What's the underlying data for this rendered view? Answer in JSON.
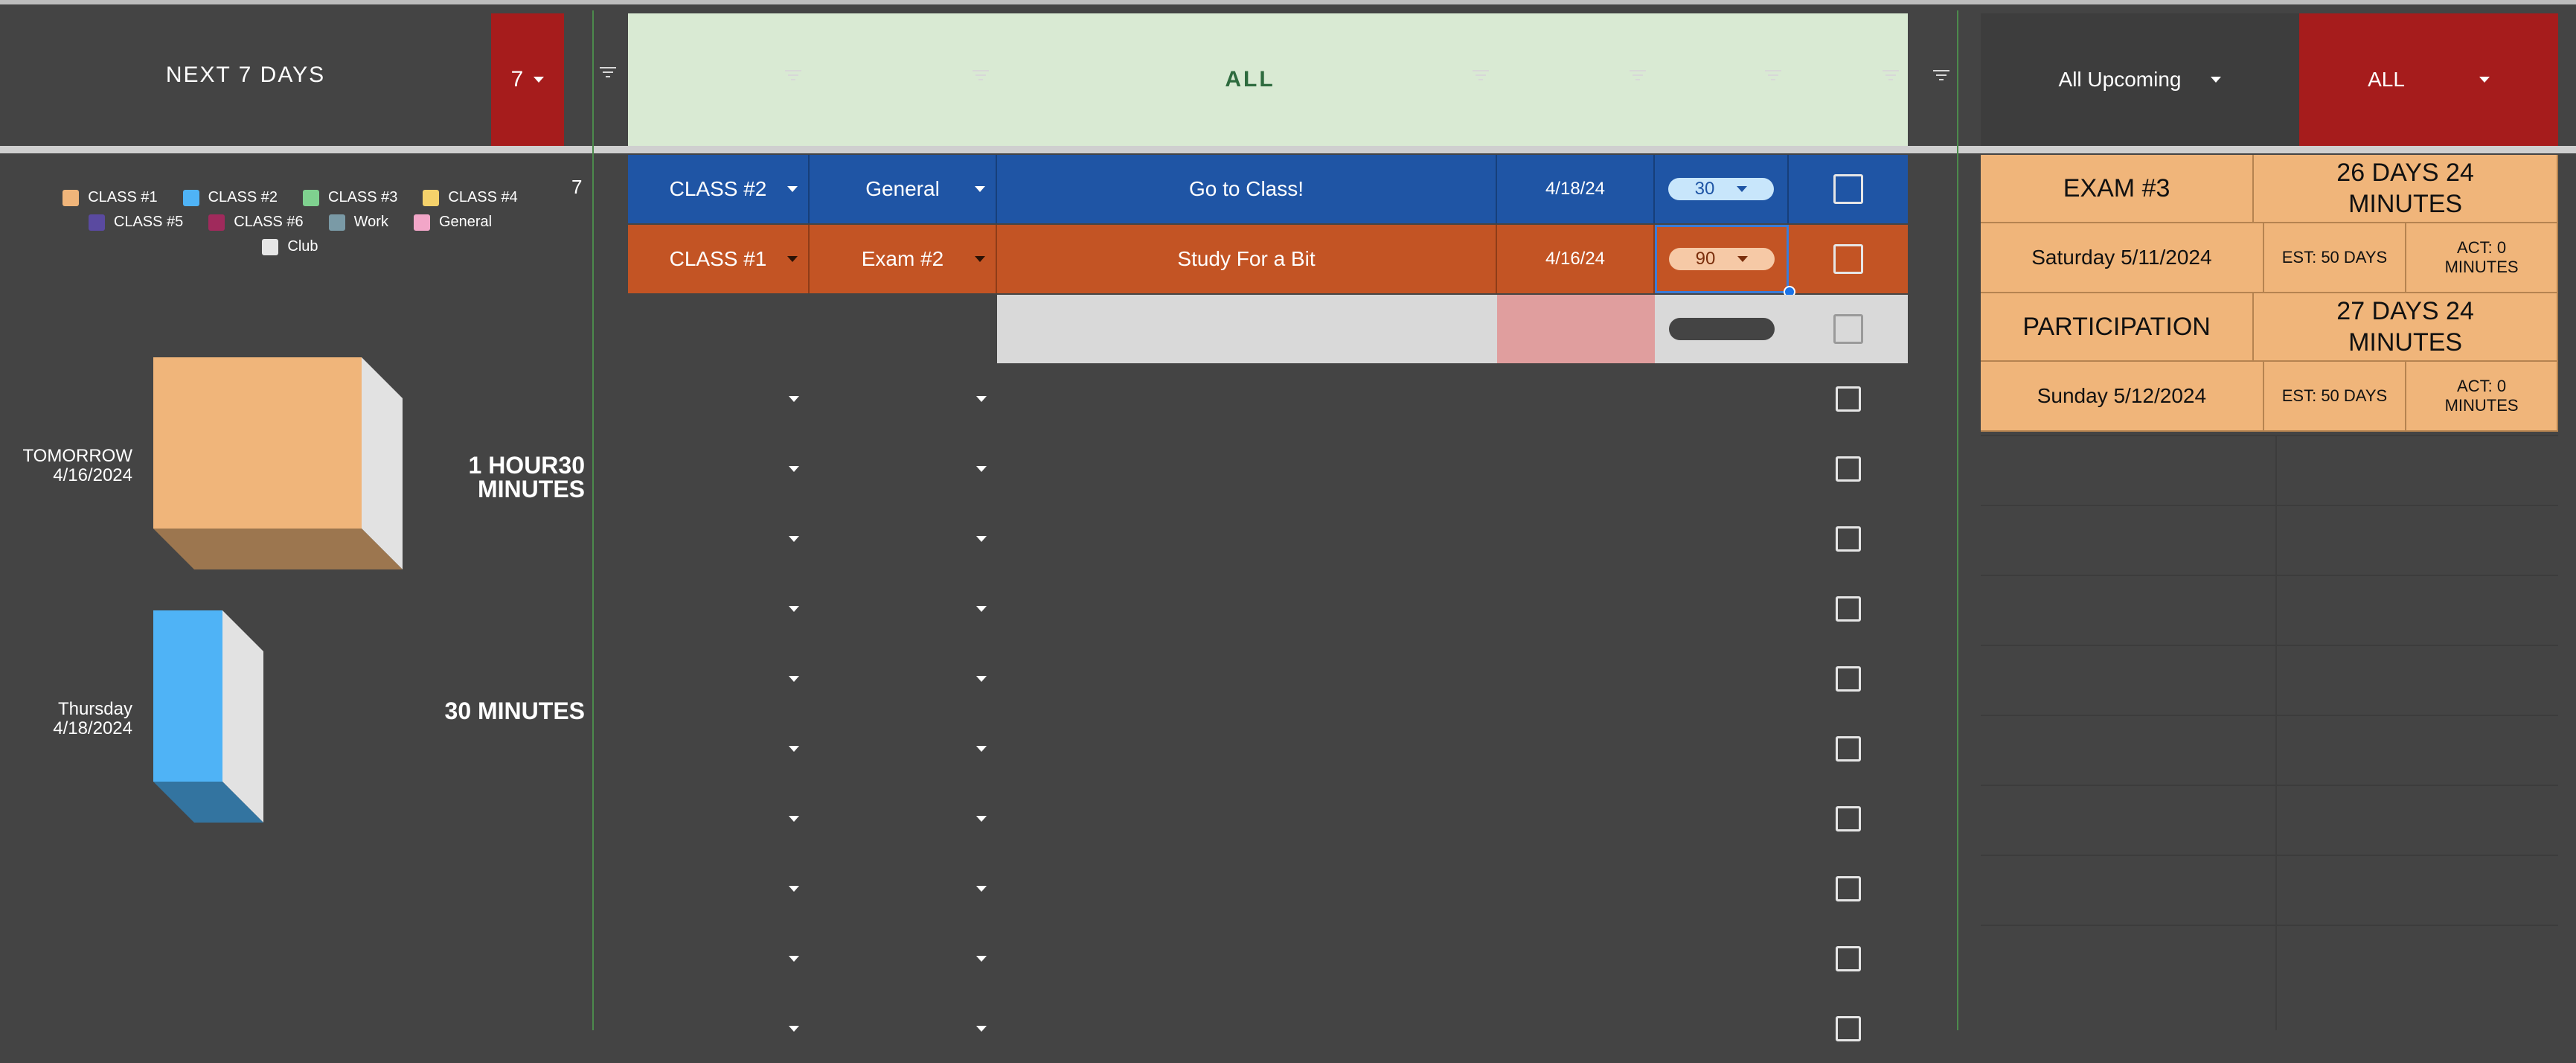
{
  "header": {
    "range_label": "NEXT 7 DAYS",
    "days_value": "7",
    "filter_all_label": "ALL",
    "upcoming_select": "All Upcoming",
    "class_select": "ALL"
  },
  "left_count": "7",
  "legend": [
    {
      "label": "CLASS #1",
      "color": "#f0b57a"
    },
    {
      "label": "CLASS #2",
      "color": "#4fb3f6"
    },
    {
      "label": "CLASS #3",
      "color": "#7fd18f"
    },
    {
      "label": "CLASS #4",
      "color": "#f5d26b"
    },
    {
      "label": "CLASS #5",
      "color": "#5a4aa0"
    },
    {
      "label": "CLASS #6",
      "color": "#a02a5c"
    },
    {
      "label": "Work",
      "color": "#7a9aa6"
    },
    {
      "label": "General",
      "color": "#f2a6c8"
    },
    {
      "label": "Club",
      "color": "#e6e6e6"
    }
  ],
  "chart_data": {
    "type": "bar",
    "categories": [
      "TOMORROW 4/16/2024",
      "Thursday 4/18/2024"
    ],
    "values": [
      90,
      30
    ],
    "value_labels": [
      "1 HOUR30 MINUTES",
      "30 MINUTES"
    ],
    "colors": [
      "#f0b57a",
      "#4fb3f6"
    ]
  },
  "tasks": [
    {
      "class": "CLASS #2",
      "type": "General",
      "task": "Go to Class!",
      "date": "4/18/24",
      "minutes": "30",
      "done": false
    },
    {
      "class": "CLASS #1",
      "type": "Exam #2",
      "task": "Study For a Bit",
      "date": "4/16/24",
      "minutes": "90",
      "done": false
    }
  ],
  "upcoming": [
    {
      "name": "EXAM #3",
      "countdown": "26 DAYS 24 MINUTES",
      "date": "Saturday 5/11/2024",
      "est": "EST: 50 DAYS",
      "act": "ACT: 0 MINUTES"
    },
    {
      "name": "PARTICIPATION",
      "countdown": "27 DAYS 24 MINUTES",
      "date": "Sunday 5/12/2024",
      "est": "EST: 50 DAYS",
      "act": "ACT: 0 MINUTES"
    }
  ],
  "colors": {
    "class1": "#c35424",
    "class2": "#1f55a5",
    "header_green": "#d9ead3",
    "accent_red": "#a61c1c",
    "empty_row_gray": "#d9d9d9",
    "empty_date_pink": "#e09e9e"
  }
}
